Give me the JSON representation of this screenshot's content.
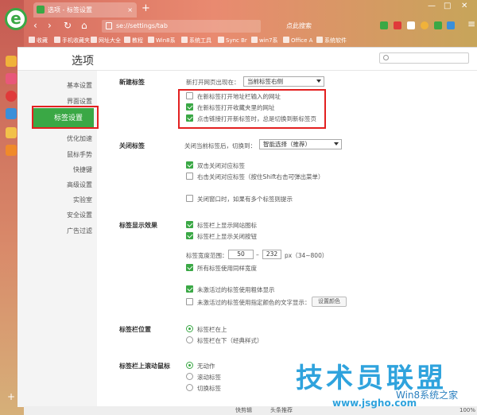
{
  "browser": {
    "tab_title": "选项 - 标签设置",
    "tab_close": "×",
    "new_tab": "+",
    "address": "se://settings/tab",
    "search_placeholder": "点此搜索",
    "window_min": "—",
    "window_max": "□",
    "window_close": "✕",
    "nav": {
      "back": "‹",
      "forward": "›",
      "refresh": "↻",
      "home": "⌂",
      "menu": "≡"
    }
  },
  "bookmarks": [
    {
      "label": "收藏"
    },
    {
      "label": "手机收藏夹"
    },
    {
      "label": "网址大全"
    },
    {
      "label": "教程"
    },
    {
      "label": "Win8系"
    },
    {
      "label": "系统工具"
    },
    {
      "label": "Sync Br"
    },
    {
      "label": "win7系"
    },
    {
      "label": "Office A"
    },
    {
      "label": "系统软件"
    }
  ],
  "page": {
    "title": "选项",
    "search_placeholder": ""
  },
  "menu": [
    {
      "label": "基本设置",
      "active": false
    },
    {
      "label": "界面设置",
      "active": false
    },
    {
      "label": "标签设置",
      "active": true
    },
    {
      "label": "优化加速",
      "active": false
    },
    {
      "label": "鼠标手势",
      "active": false
    },
    {
      "label": "快捷键",
      "active": false
    },
    {
      "label": "高级设置",
      "active": false
    },
    {
      "label": "实验室",
      "active": false
    },
    {
      "label": "安全设置",
      "active": false
    },
    {
      "label": "广告过滤",
      "active": false
    }
  ],
  "sections": {
    "new_tab": {
      "title": "新建标签",
      "open_position_label": "新打开网页出现在：",
      "open_position_value": "当前标签右侧",
      "options": [
        {
          "label": "在新标签打开地址栏输入的网址",
          "checked": false
        },
        {
          "label": "在新标签打开收藏夹里的网址",
          "checked": true
        },
        {
          "label": "点击链接打开新标签时，总是切换到新标签页",
          "checked": true
        }
      ]
    },
    "close_tab": {
      "title": "关闭标签",
      "switch_label": "关闭当前标签后，切换到：",
      "switch_value": "智能选择（推荐）",
      "options": [
        {
          "label": "双击关闭对应标签",
          "checked": true
        },
        {
          "label": "右击关闭对应标签（按住Shift右击可弹出菜单）",
          "checked": false
        },
        {
          "label": "关闭窗口时，如果有多个标签则提示",
          "checked": false
        }
      ]
    },
    "display": {
      "title": "标签显示效果",
      "options_top": [
        {
          "label": "标签栏上显示网站图标",
          "checked": true
        },
        {
          "label": "标签栏上显示关闭按钮",
          "checked": true
        }
      ],
      "width_label": "标签宽度范围：",
      "width_min": "50",
      "width_sep": "–",
      "width_max": "232",
      "width_unit": "px（34~800）",
      "same_width": {
        "label": "所有标签使用同样宽度",
        "checked": true
      },
      "bold": {
        "label": "未激活过的标签使用粗体显示",
        "checked": true
      },
      "color": {
        "label": "未激活过的标签使用指定颜色的文字显示：",
        "checked": false
      },
      "color_button": "设置颜色"
    },
    "bar_position": {
      "title": "标签栏位置",
      "options": [
        {
          "label": "标签栏在上",
          "selected": true
        },
        {
          "label": "标签栏在下（经典样式）",
          "selected": false
        }
      ]
    },
    "wheel": {
      "title": "标签栏上滚动鼠标",
      "options": [
        {
          "label": "无动作",
          "selected": true
        },
        {
          "label": "滚动标签",
          "selected": false
        },
        {
          "label": "切换标签",
          "selected": false
        }
      ]
    }
  },
  "status_bar": {
    "items": [
      "快剪辑",
      "头条推荐",
      "100%"
    ]
  },
  "watermark": {
    "line1": "技术员联盟",
    "line2": "www.jsgho.com",
    "line3": "Win8系统之家"
  },
  "colors": {
    "accent": "#3aa845",
    "highlight_box": "#e32020",
    "watermark": "#2fa3dd"
  }
}
